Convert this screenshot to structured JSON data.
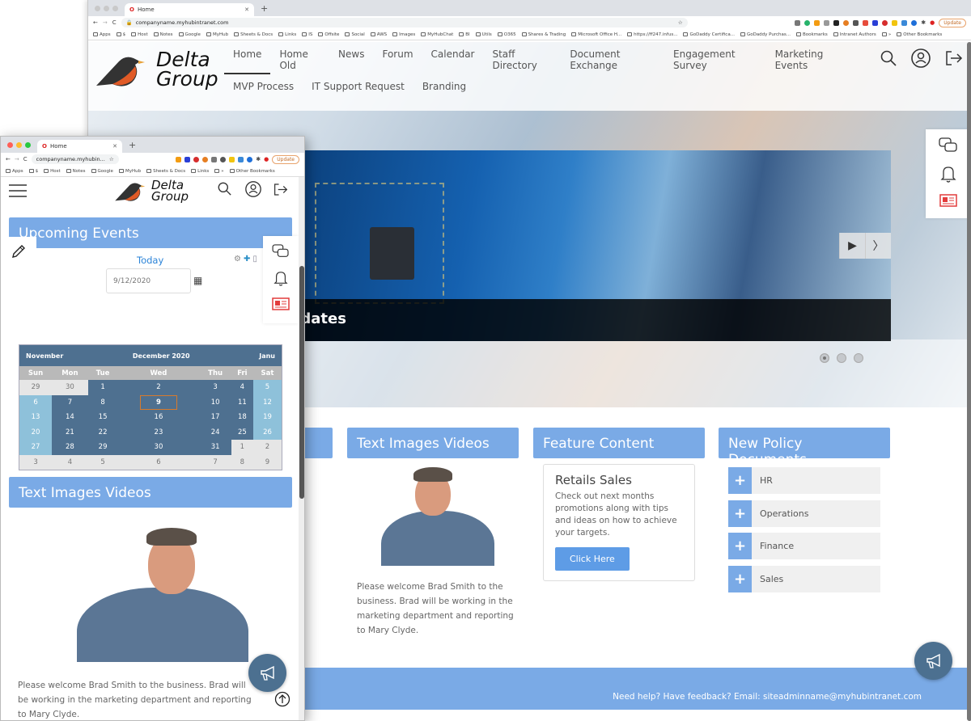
{
  "browser_large": {
    "tab_title": "Home",
    "url": "companyname.myhubintranet.com",
    "update_label": "Update",
    "bookmarks": [
      "Apps",
      "$",
      "Host",
      "Notes",
      "Google",
      "MyHub",
      "Sheets & Docs",
      "Links",
      "IS",
      "Offsite",
      "Social",
      "AWS",
      "Images",
      "MyHubChat",
      "BI",
      "Utils",
      "O365",
      "Shares & Trading",
      "Microsoft Office H...",
      "https://ff247.infus...",
      "GoDaddy Certifica...",
      "GoDaddy Purchas...",
      "Bookmarks",
      "Intranet Authors",
      "»",
      "Other Bookmarks"
    ]
  },
  "browser_small": {
    "tab_title": "Home",
    "url": "companyname.myhubin...",
    "update_label": "Update",
    "bookmarks": [
      "Apps",
      "$",
      "Host",
      "Notes",
      "Google",
      "MyHub",
      "Sheets & Docs",
      "Links",
      "»",
      "Other Bookmarks"
    ]
  },
  "site": {
    "logo_line1": "Delta",
    "logo_line2": "Group",
    "nav_row1": [
      "Home",
      "Home Old",
      "News",
      "Forum",
      "Calendar",
      "Staff Directory",
      "Document Exchange",
      "Engagement Survey",
      "Marketing Events"
    ],
    "nav_row2": [
      "MVP Process",
      "IT Support Request",
      "Branding"
    ],
    "active_nav": "Home",
    "icons": {
      "search": "search-icon",
      "account": "account-icon",
      "logout": "logout-icon",
      "chat": "chat-icon",
      "bell": "bell-icon",
      "news": "news-icon",
      "megaphone": "megaphone-icon",
      "arrow_up": "arrow-up-icon"
    }
  },
  "slider": {
    "caption": "odates",
    "pages": 3,
    "current_page": 1
  },
  "sections": {
    "text_images_videos": {
      "title": "Text Images Videos",
      "welcome": "Please welcome Brad Smith to the business. Brad will be working in the marketing department and reporting to Mary Clyde.",
      "welcome_small": "Please welcome Brad Smith to the business. Brad will be working in the marketing department and reporting to Mary Clyde."
    },
    "feature_content": {
      "title": "Feature Content",
      "card_title": "Retails Sales",
      "card_text": "Check out next months promotions along with tips and ideas on how to achieve your targets.",
      "button": "Click Here"
    },
    "policy": {
      "title": "New Policy Documents",
      "items": [
        "HR",
        "Operations",
        "Finance",
        "Sales"
      ]
    },
    "upcoming_events": {
      "title": "Upcoming Events",
      "today_label": "Today",
      "date_value": "9/12/2020"
    }
  },
  "calendar": {
    "prev": "November",
    "current": "December 2020",
    "next": "Janu",
    "weekdays": [
      "Sun",
      "Mon",
      "Tue",
      "Wed",
      "Thu",
      "Fri",
      "Sat"
    ],
    "weeks": [
      [
        "29",
        "30",
        "1",
        "2",
        "3",
        "4",
        "5"
      ],
      [
        "6",
        "7",
        "8",
        "9",
        "10",
        "11",
        "12"
      ],
      [
        "13",
        "14",
        "15",
        "16",
        "17",
        "18",
        "19"
      ],
      [
        "20",
        "21",
        "22",
        "23",
        "24",
        "25",
        "26"
      ],
      [
        "27",
        "28",
        "29",
        "30",
        "31",
        "1",
        "2"
      ],
      [
        "3",
        "4",
        "5",
        "6",
        "7",
        "8",
        "9"
      ]
    ],
    "selected": "9"
  },
  "footer": {
    "text": "Need help? Have feedback? Email: siteadminname@myhubintranet.com"
  },
  "colors": {
    "accent": "#7aaae6",
    "button": "#5e9ce6",
    "calendar_dark": "#4e7090",
    "weekend": "#8ec1da",
    "fab": "#4c7090",
    "highlight": "#d77a2c"
  }
}
